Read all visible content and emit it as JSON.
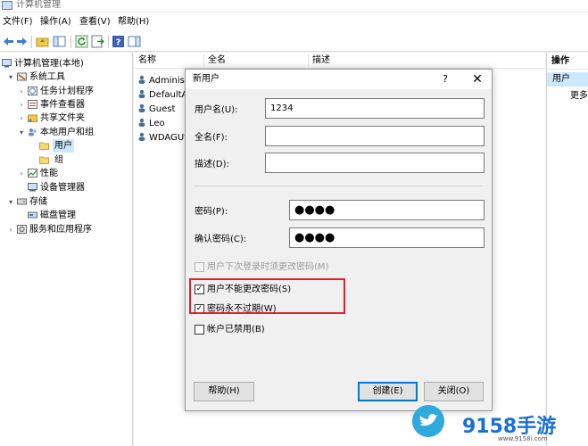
{
  "window": {
    "title": "计算机管理"
  },
  "menubar": {
    "items": [
      "文件(F)",
      "操作(A)",
      "查看(V)",
      "帮助(H)"
    ]
  },
  "tree": {
    "items": [
      {
        "label": "计算机管理(本地)",
        "level": 0,
        "caret": "",
        "selected": false
      },
      {
        "label": "系统工具",
        "level": 1,
        "caret": "▾",
        "selected": false
      },
      {
        "label": "任务计划程序",
        "level": 2,
        "caret": "›",
        "selected": false
      },
      {
        "label": "事件查看器",
        "level": 2,
        "caret": "›",
        "selected": false
      },
      {
        "label": "共享文件夹",
        "level": 2,
        "caret": "›",
        "selected": false
      },
      {
        "label": "本地用户和组",
        "level": 2,
        "caret": "▾",
        "selected": false
      },
      {
        "label": "用户",
        "level": 3,
        "caret": "",
        "selected": true
      },
      {
        "label": "组",
        "level": 3,
        "caret": "",
        "selected": false
      },
      {
        "label": "性能",
        "level": 2,
        "caret": "›",
        "selected": false
      },
      {
        "label": "设备管理器",
        "level": 2,
        "caret": "",
        "selected": false
      },
      {
        "label": "存储",
        "level": 1,
        "caret": "▾",
        "selected": false
      },
      {
        "label": "磁盘管理",
        "level": 2,
        "caret": "",
        "selected": false
      },
      {
        "label": "服务和应用程序",
        "level": 1,
        "caret": "›",
        "selected": false
      }
    ]
  },
  "list": {
    "columns": [
      "名称",
      "全名",
      "描述"
    ],
    "rows": [
      "Administ",
      "DefaultA",
      "Guest",
      "Leo",
      "WDAGUt"
    ]
  },
  "actions": {
    "header": "操作",
    "selected": "用户",
    "more": "更多"
  },
  "dialog": {
    "title": "新用户",
    "help_glyph": "?",
    "close_glyph": "✕",
    "username_label": "用户名(U):",
    "username_value": "1234",
    "fullname_label": "全名(F):",
    "fullname_value": "",
    "description_label": "描述(D):",
    "description_value": "",
    "password_label": "密码(P):",
    "password_value": "●●●●",
    "confirm_label": "确认密码(C):",
    "confirm_value": "●●●●",
    "options": [
      {
        "label": "用户下次登录时须更改密码(M)",
        "checked": false,
        "enabled": false
      },
      {
        "label": "用户不能更改密码(S)",
        "checked": true,
        "enabled": true
      },
      {
        "label": "密码永不过期(W)",
        "checked": true,
        "enabled": true
      },
      {
        "label": "帐户已禁用(B)",
        "checked": false,
        "enabled": true
      }
    ],
    "help_button": "帮助(H)",
    "create_button": "创建(E)",
    "close_button": "关闭(O)"
  },
  "watermark": {
    "brand": "9158手游",
    "url": "www.9158i.com"
  },
  "colors": {
    "highlight": "#e0232b",
    "selection": "#cce8ff",
    "accent": "#0078d7",
    "watermark": "#2eaadc"
  }
}
